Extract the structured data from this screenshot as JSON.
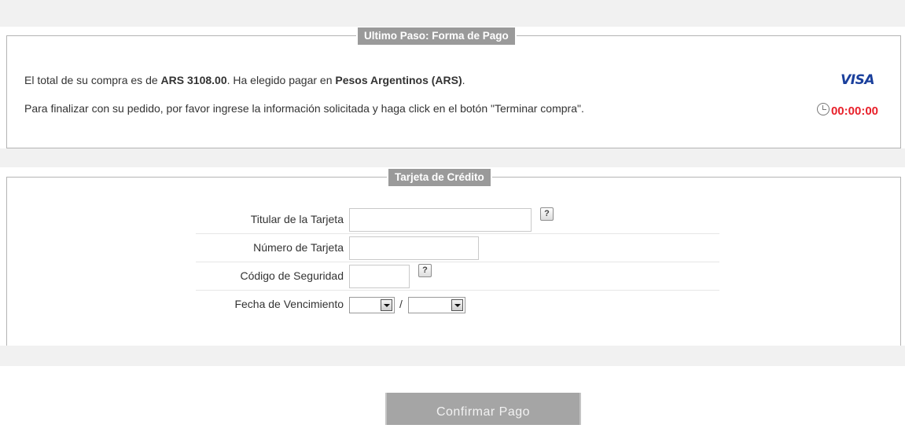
{
  "payment_panel": {
    "title": "Ultimo Paso: Forma de Pago",
    "line1_prefix": "El total de su compra es de ",
    "total": "ARS 3108.00",
    "line1_middle": ". Ha elegido pagar en ",
    "currency": "Pesos Argentinos (ARS)",
    "line1_suffix": ".",
    "line2": "Para finalizar con su pedido, por favor ingrese la información solicitada y haga click en el botón \"Terminar compra\".",
    "card_brand": "VISA",
    "timer": "00:00:00",
    "timer_icon": "clock-icon"
  },
  "card_panel": {
    "title": "Tarjeta de Crédito",
    "fields": {
      "holder_label": "Titular de la Tarjeta",
      "holder_value": "",
      "number_label": "Número de Tarjeta",
      "number_value": "",
      "cvv_label": "Código de Seguridad",
      "cvv_value": "",
      "expiry_label": "Fecha de Vencimiento",
      "expiry_month": "",
      "expiry_separator": "/",
      "expiry_year": ""
    },
    "help_label": "?"
  },
  "confirm_button": "Confirmar Pago",
  "colors": {
    "legend_bg": "#9a9a9a",
    "timer": "#e8202a",
    "visa": "#1a3f9c",
    "button_bg": "#a5a5a5"
  }
}
